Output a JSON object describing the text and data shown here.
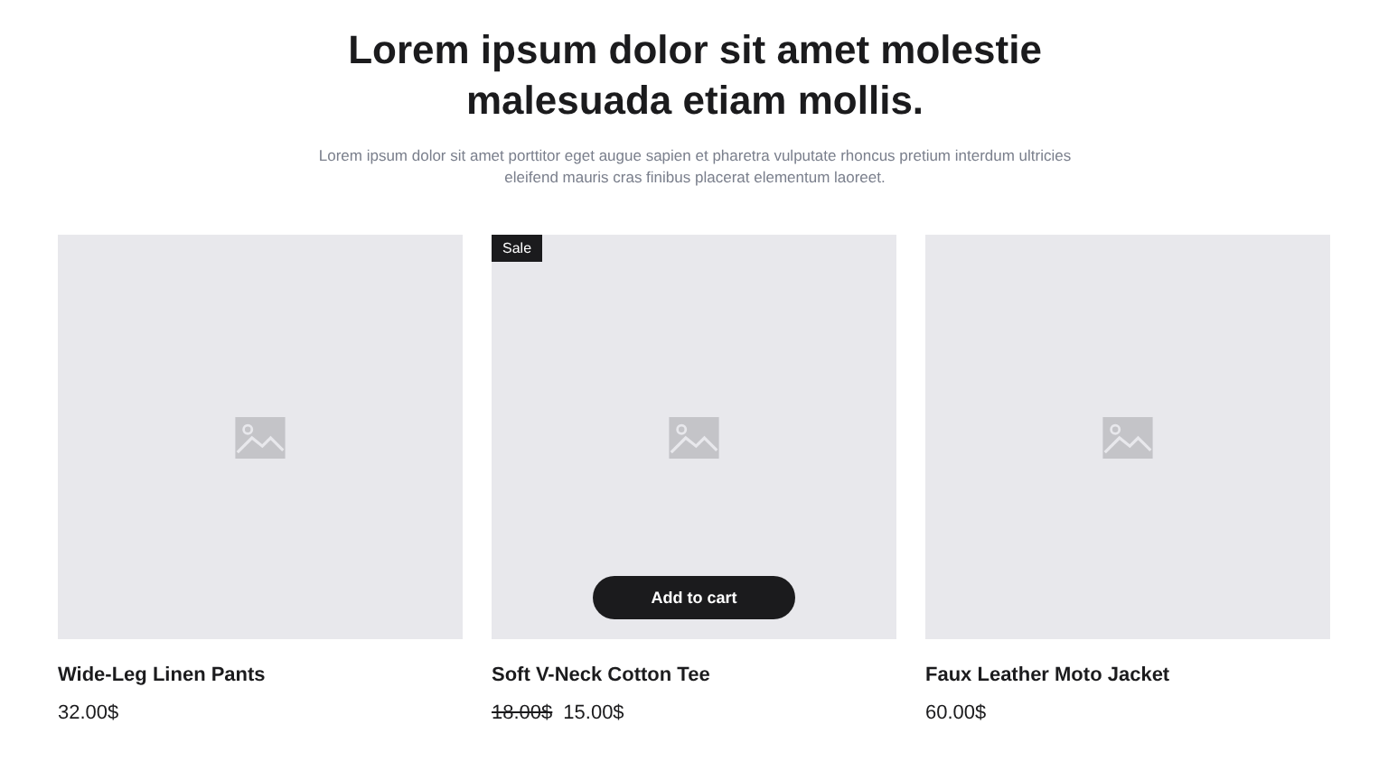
{
  "heading": "Lorem ipsum dolor sit amet molestie malesuada etiam mollis.",
  "subtitle": "Lorem ipsum dolor sit amet porttitor eget augue sapien et pharetra vulputate rhoncus pretium interdum ultricies eleifend mauris cras finibus placerat elementum laoreet.",
  "products": [
    {
      "name": "Wide-Leg Linen Pants",
      "price": "32.00$"
    },
    {
      "name": "Soft V-Neck Cotton Tee",
      "badge": "Sale",
      "old_price": "18.00$",
      "price": "15.00$",
      "button": "Add to cart"
    },
    {
      "name": "Faux Leather Moto Jacket",
      "price": "60.00$"
    }
  ]
}
